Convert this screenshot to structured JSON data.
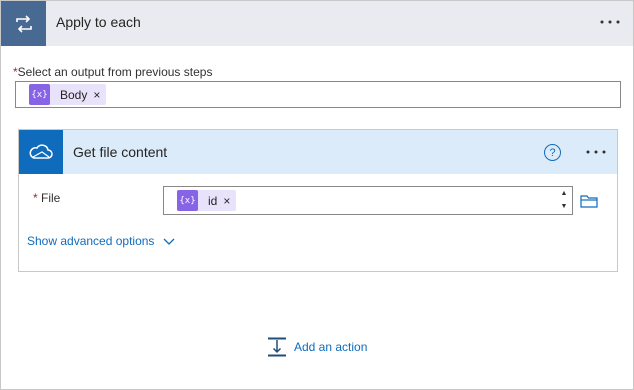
{
  "loop": {
    "title": "Apply to each",
    "icon": "loop-icon",
    "more_icon": "more-icon"
  },
  "output_field": {
    "required_mark": "*",
    "label": "Select an output from previous steps",
    "token": {
      "icon": "expression-icon",
      "glyph": "{x}",
      "label": "Body",
      "remove": "×"
    }
  },
  "action": {
    "title": "Get file content",
    "icon": "onedrive-cloud-icon",
    "help_glyph": "?",
    "file_field": {
      "required_mark": "*",
      "label": "File",
      "token": {
        "icon": "expression-icon",
        "glyph": "{x}",
        "label": "id",
        "remove": "×"
      },
      "spin_up": "▲",
      "spin_down": "▼",
      "picker_icon": "folder-icon"
    },
    "advanced_label": "Show advanced options"
  },
  "add_action_label": "Add an action",
  "colors": {
    "loop_header_bg": "#e9ebf0",
    "loop_icon_bg": "#486991",
    "action_header_bg": "#dcebf9",
    "action_icon_bg": "#0f6cbd",
    "token_bg": "#e9e2fb",
    "token_icon_bg": "#8763e6",
    "link": "#0f6cbd",
    "required": "#a4262c"
  }
}
